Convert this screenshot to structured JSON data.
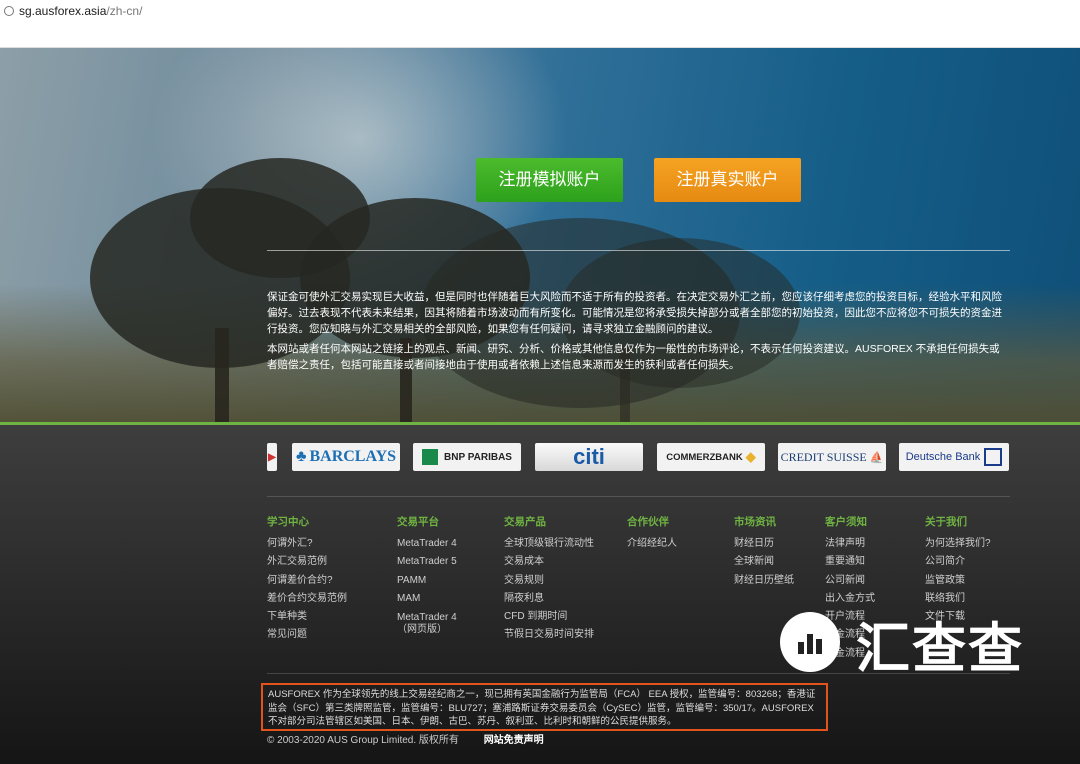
{
  "browser": {
    "url_domain": "sg.ausforex.asia",
    "url_path": "/zh-cn/"
  },
  "hero": {
    "demo_button": "注册模拟账户",
    "real_button": "注册真实账户",
    "disclaimer_1": "保证金可使外汇交易实现巨大收益，但是同时也伴随着巨大风险而不适于所有的投资者。在决定交易外汇之前，您应该仔细考虑您的投资目标，经验水平和风险偏好。过去表现不代表未来结果，因其将随着市场波动而有所变化。可能情况是您将承受损失掉部分或者全部您的初始投资，因此您不应将您不可损失的资金进行投资。您应知晓与外汇交易相关的全部风险，如果您有任何疑问，请寻求独立金融顾问的建议。",
    "disclaimer_2": "本网站或者任何本网站之链接上的观点、新闻、研究、分析、价格或其他信息仅作为一般性的市场评论，不表示任何投资建议。AUSFOREX 不承担任何损失或者赔偿之责任，包括可能直接或者间接地由于使用或者依赖上述信息来源而发生的获利或者任何损失。"
  },
  "partners": [
    "BARCLAYS",
    "BNP PARIBAS",
    "citi",
    "COMMERZBANK",
    "CREDIT SUISSE",
    "Deutsche Bank"
  ],
  "footer_columns": [
    {
      "head": "学习中心",
      "items": [
        "何谓外汇?",
        "外汇交易范例",
        "何谓差价合约?",
        "差价合约交易范例",
        "下单种类",
        "常见问题"
      ]
    },
    {
      "head": "交易平台",
      "items": [
        "MetaTrader 4",
        "MetaTrader 5",
        "PAMM",
        "MAM",
        "MetaTrader 4",
        "（网页版）"
      ]
    },
    {
      "head": "交易产品",
      "items": [
        "全球顶级银行流动性",
        "交易成本",
        "交易规则",
        "隔夜利息",
        "CFD 到期时间",
        "节假日交易时间安排"
      ]
    },
    {
      "head": "合作伙伴",
      "items": [
        "介绍经纪人"
      ]
    },
    {
      "head": "市场资讯",
      "items": [
        "财经日历",
        "全球新闻",
        "财经日历壁纸"
      ]
    },
    {
      "head": "客户须知",
      "items": [
        "法律声明",
        "重要通知",
        "公司新闻",
        "出入金方式",
        "开户流程",
        "出金流程",
        "入金流程"
      ]
    },
    {
      "head": "关于我们",
      "items": [
        "为何选择我们?",
        "公司简介",
        "监管政策",
        "联络我们",
        "文件下载"
      ]
    }
  ],
  "notice": "AUSFOREX 作为全球领先的线上交易经纪商之一，现已拥有英国金融行为监管局（FCA） EEA 授权，监管编号：803268；香港证监会（SFC）第三类牌照监管，监管编号：BLU727；塞浦路斯证券交易委员会（CySEC）监管，监管编号：350/17。AUSFOREX 不对部分司法管辖区如美国、日本、伊朗、古巴、苏丹、叙利亚、比利时和朝鲜的公民提供服务。",
  "copyright": "© 2003-2020 AUS Group Limited. 版权所有",
  "disclaimer_link": "网站免责声明",
  "watermark": "汇查查",
  "colors": {
    "accent_green": "#6fb342",
    "demo_button": "#3bae24",
    "real_button": "#f0991a",
    "highlight_box": "#e2541b"
  }
}
